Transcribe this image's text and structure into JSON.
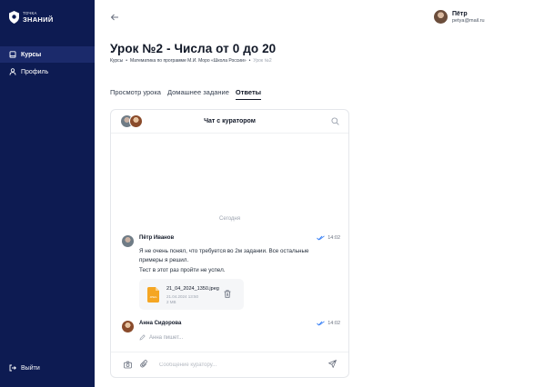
{
  "logo": {
    "line1": "ТОЧКА",
    "line2": "ЗНАНИЙ"
  },
  "sidebar": {
    "items": [
      {
        "label": "Курсы",
        "icon": "book-icon",
        "active": true
      },
      {
        "label": "Профиль",
        "icon": "person-icon",
        "active": false
      }
    ],
    "logout_label": "Выйти"
  },
  "user": {
    "name": "Пётр",
    "email": "petya@mail.ru"
  },
  "page": {
    "title": "Урок №2 - Числа от 0 до 20",
    "breadcrumb": [
      "Курсы",
      "Математика по программе М.И. Моро «Школа России»",
      "Урок №2"
    ]
  },
  "tabs": [
    {
      "label": "Просмотр урока",
      "active": false
    },
    {
      "label": "Домашнее задание",
      "active": false
    },
    {
      "label": "Ответы",
      "active": true
    }
  ],
  "chat": {
    "title": "Чат с куратором",
    "day_separator": "Сегодня",
    "messages": [
      {
        "author": "Пётр Иванов",
        "time": "14:02",
        "text_lines": [
          "Я не очень понял, что требуется во 2м задании. Все остальные",
          "примеры я решил.",
          "Тест в этот раз пройти не успел."
        ],
        "attachment": {
          "name": "21_04_2024_1350.jpeg",
          "date": "21.04.2024 13:50",
          "size": "2 MB",
          "ext": "JPEG"
        }
      },
      {
        "author": "Анна Сидорова",
        "time": "14:02",
        "typing": "Анна пишет..."
      }
    ],
    "composer_placeholder": "Сообщение куратору..."
  },
  "colors": {
    "sidebar_bg": "#0d1b52",
    "sidebar_active": "#1b2a6b",
    "read_check": "#3b82f6",
    "file_icon": "#f5a623"
  }
}
